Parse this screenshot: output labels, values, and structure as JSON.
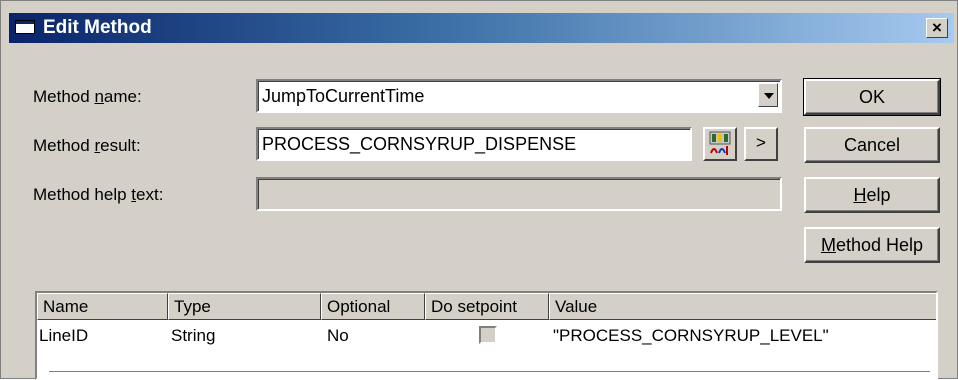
{
  "window": {
    "title": "Edit Method",
    "close_label": "×"
  },
  "fields": {
    "method_name": {
      "label_pre": "Method ",
      "label_key": "n",
      "label_post": "ame:",
      "value": "JumpToCurrentTime"
    },
    "method_result": {
      "label_pre": "Method ",
      "label_key": "r",
      "label_post": "esult:",
      "value": "PROCESS_CORNSYRUP_DISPENSE",
      "arrow_label": ">"
    },
    "method_help": {
      "label_pre": "Method help ",
      "label_key": "t",
      "label_post": "ext:",
      "value": ""
    }
  },
  "buttons": {
    "ok": "OK",
    "cancel": "Cancel",
    "help_key": "H",
    "help_rest": "elp",
    "method_help_key": "M",
    "method_help_rest": "ethod Help"
  },
  "table": {
    "columns": [
      "Name",
      "Type",
      "Optional",
      "Do setpoint",
      "Value"
    ],
    "rows": [
      {
        "name": "LineID",
        "type": "String",
        "optional": "No",
        "do_setpoint": false,
        "value": "\"PROCESS_CORNSYRUP_LEVEL\""
      }
    ]
  },
  "icons": {
    "title": "window-icon",
    "browse": "tag-browser-icon",
    "close": "close-icon"
  }
}
